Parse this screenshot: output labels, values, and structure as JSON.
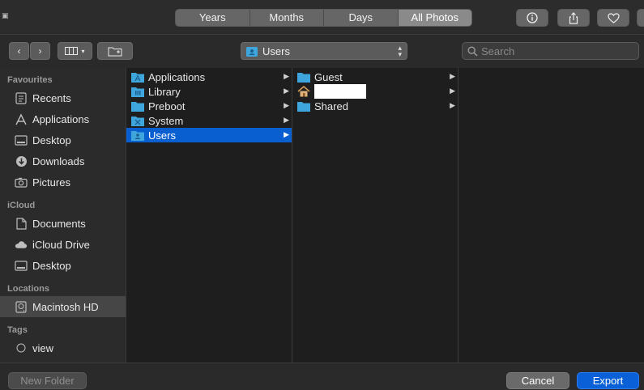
{
  "toolbar": {
    "segments": [
      {
        "label": "Years",
        "active": false
      },
      {
        "label": "Months",
        "active": false
      },
      {
        "label": "Days",
        "active": false
      },
      {
        "label": "All Photos",
        "active": true
      }
    ],
    "icons": [
      "info-icon",
      "share-icon",
      "heart-icon"
    ]
  },
  "browser": {
    "location": "Users",
    "search_placeholder": "Search"
  },
  "sidebar": {
    "favourites_heading": "Favourites",
    "favourites": [
      {
        "label": "Recents",
        "icon": "recents-icon"
      },
      {
        "label": "Applications",
        "icon": "applications-icon"
      },
      {
        "label": "Desktop",
        "icon": "desktop-icon"
      },
      {
        "label": "Downloads",
        "icon": "downloads-icon"
      },
      {
        "label": "Pictures",
        "icon": "pictures-icon"
      }
    ],
    "icloud_heading": "iCloud",
    "icloud": [
      {
        "label": "Documents",
        "icon": "documents-icon"
      },
      {
        "label": "iCloud Drive",
        "icon": "cloud-icon"
      },
      {
        "label": "Desktop",
        "icon": "desktop-icon"
      }
    ],
    "locations_heading": "Locations",
    "locations": [
      {
        "label": "Macintosh HD",
        "icon": "disk-icon",
        "selected": true
      }
    ],
    "tags_heading": "Tags",
    "tags": [
      {
        "label": "view",
        "icon": "tag-circle-icon"
      }
    ]
  },
  "columns": {
    "col1": [
      {
        "label": "Applications",
        "has_children": true
      },
      {
        "label": "Library",
        "has_children": true
      },
      {
        "label": "Preboot",
        "has_children": true
      },
      {
        "label": "System",
        "has_children": true
      },
      {
        "label": "Users",
        "has_children": true,
        "selected": true
      }
    ],
    "col2": [
      {
        "label": "Guest",
        "has_children": true
      },
      {
        "label": "",
        "has_children": true,
        "redacted": true
      },
      {
        "label": "Shared",
        "has_children": true
      }
    ]
  },
  "buttons": {
    "new_folder": "New Folder",
    "cancel": "Cancel",
    "export": "Export"
  },
  "colors": {
    "accent": "#0a60d6",
    "folder": "#3ea6dd"
  }
}
